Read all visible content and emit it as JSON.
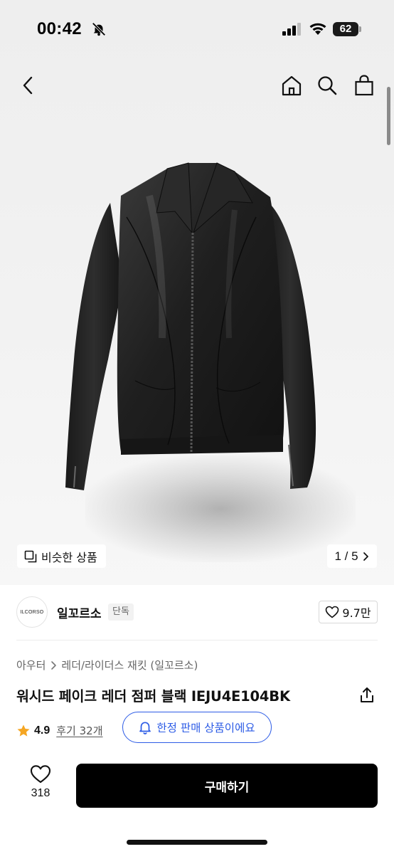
{
  "status_bar": {
    "time": "00:42",
    "battery": "62",
    "icons": [
      "bell-off-icon",
      "signal-icon",
      "wifi-icon",
      "battery-icon"
    ]
  },
  "header": {
    "icons": [
      "back-chevron-icon",
      "home-icon",
      "search-icon",
      "shopping-bag-icon"
    ]
  },
  "gallery": {
    "similar_label": "비슷한 상품",
    "page_indicator": "1 / 5",
    "current_page": 1,
    "total_pages": 5
  },
  "seller": {
    "logo_text": "ILCORSO",
    "name": "일꼬르소",
    "badge": "단독",
    "likes": "9.7만"
  },
  "product": {
    "category": "아우터",
    "subcategory": "레더/라이더스 재킷 (일꼬르소)",
    "title": "워시드 페이크 레더 점퍼 블랙 IEJU4E104BK",
    "rating": "4.9",
    "reviews": "후기 32개",
    "limited_notice": "한정 판매 상품이에요"
  },
  "bottom_bar": {
    "wishlist_count": "318",
    "buy_label": "구매하기"
  },
  "colors": {
    "accent": "#2d5ce6",
    "star": "#f5a623",
    "buy_button": "#000000"
  }
}
